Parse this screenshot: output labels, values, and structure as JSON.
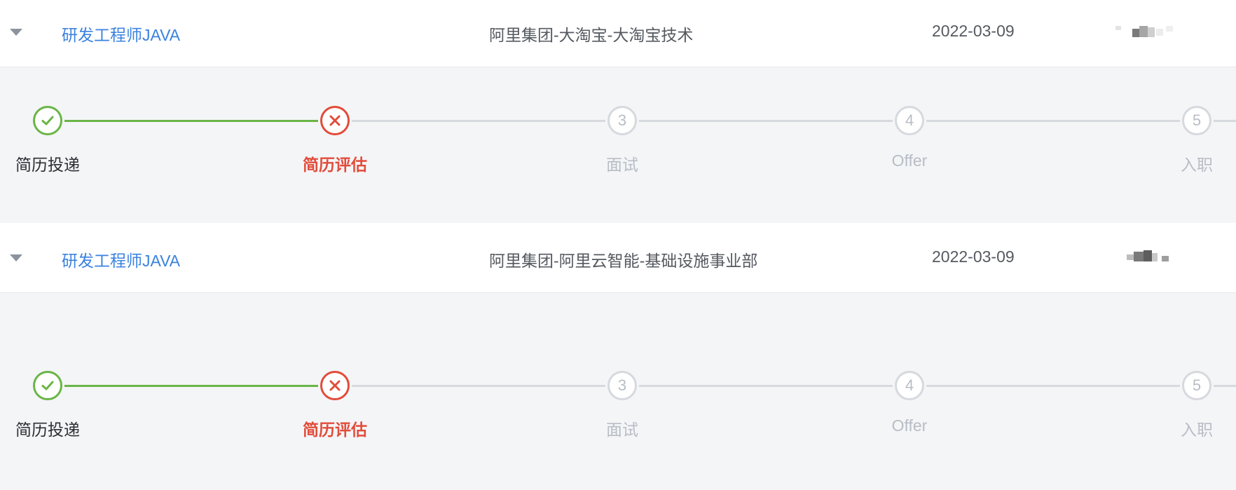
{
  "applications": [
    {
      "position_title": "研发工程师JAVA",
      "department": "阿里集团-大淘宝-大淘宝技术",
      "date": "2022-03-09",
      "steps": [
        {
          "label": "简历投递",
          "status": "done",
          "number": "1"
        },
        {
          "label": "简历评估",
          "status": "fail",
          "number": "2"
        },
        {
          "label": "面试",
          "status": "wait",
          "number": "3"
        },
        {
          "label": "Offer",
          "status": "wait",
          "number": "4"
        },
        {
          "label": "入职",
          "status": "wait",
          "number": "5"
        }
      ]
    },
    {
      "position_title": "研发工程师JAVA",
      "department": "阿里集团-阿里云智能-基础设施事业部",
      "date": "2022-03-09",
      "steps": [
        {
          "label": "简历投递",
          "status": "done",
          "number": "1"
        },
        {
          "label": "简历评估",
          "status": "fail",
          "number": "2"
        },
        {
          "label": "面试",
          "status": "wait",
          "number": "3"
        },
        {
          "label": "Offer",
          "status": "wait",
          "number": "4"
        },
        {
          "label": "入职",
          "status": "wait",
          "number": "5"
        }
      ]
    }
  ],
  "colors": {
    "done": "#6ab547",
    "fail": "#e24c3a",
    "wait": "#d6d9de",
    "link": "#3b82e0"
  },
  "icons": {
    "done": "check-icon",
    "fail": "x-icon",
    "collapse": "caret-down-icon"
  }
}
